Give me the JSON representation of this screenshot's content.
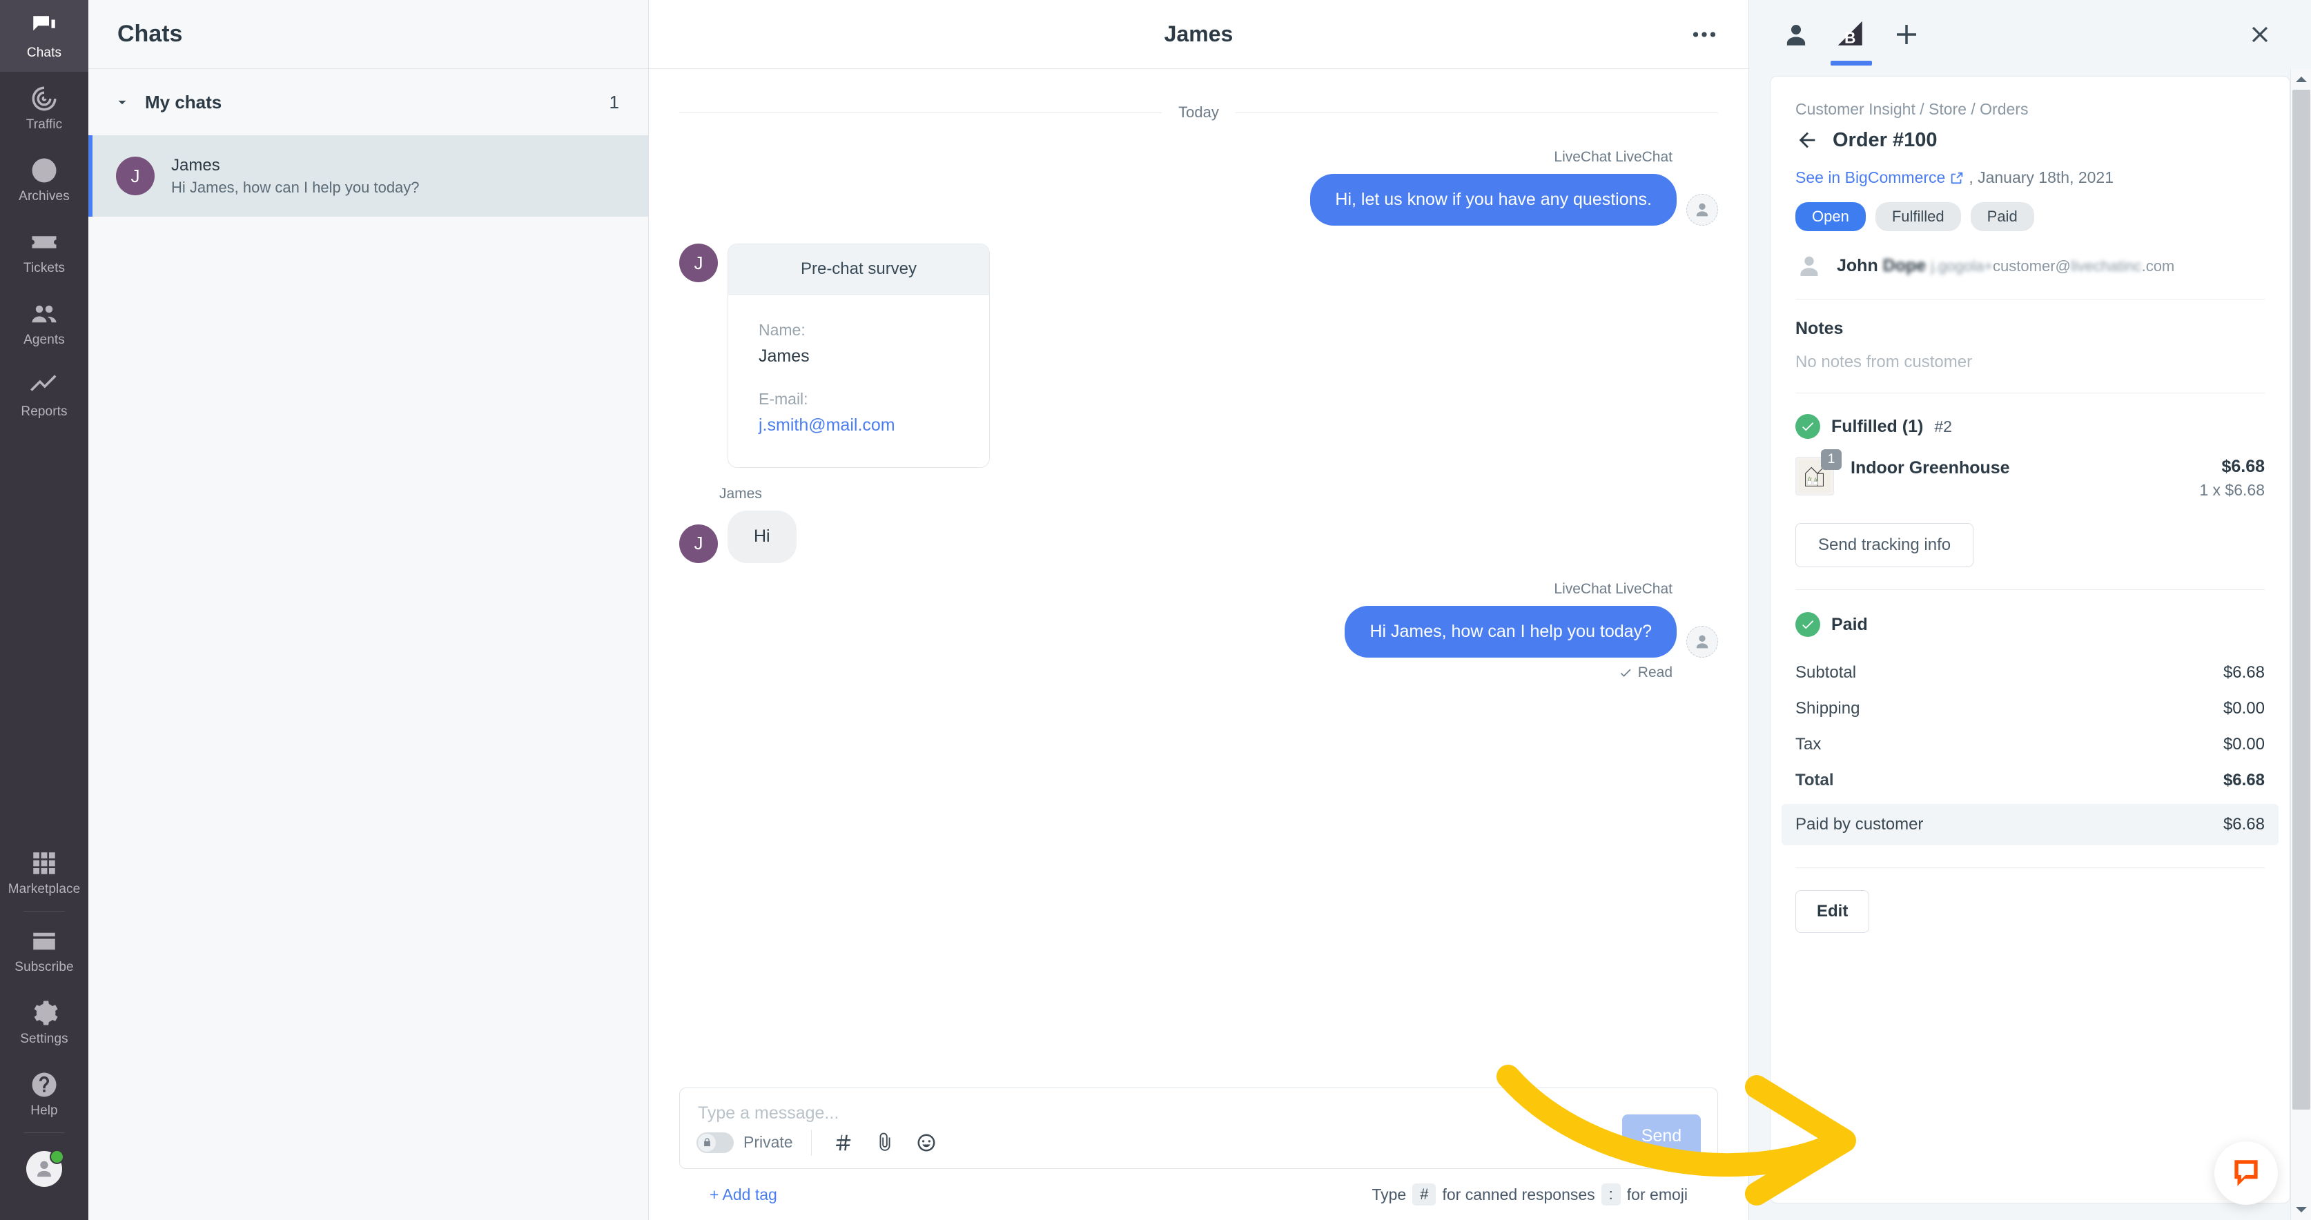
{
  "nav": {
    "top_items": [
      {
        "label": "Chats",
        "icon": "chats-icon",
        "active": true
      },
      {
        "label": "Traffic",
        "icon": "traffic-icon",
        "active": false
      },
      {
        "label": "Archives",
        "icon": "archives-clock-icon",
        "active": false
      },
      {
        "label": "Tickets",
        "icon": "tickets-icon",
        "active": false
      },
      {
        "label": "Agents",
        "icon": "agents-people-icon",
        "active": false
      },
      {
        "label": "Reports",
        "icon": "reports-chart-icon",
        "active": false
      }
    ],
    "bottom_items": [
      {
        "label": "Marketplace",
        "icon": "marketplace-grid-icon"
      },
      {
        "label": "Subscribe",
        "icon": "subscribe-card-icon"
      },
      {
        "label": "Settings",
        "icon": "gear-icon"
      },
      {
        "label": "Help",
        "icon": "help-question-icon"
      }
    ]
  },
  "chatlist": {
    "title": "Chats",
    "group_label": "My chats",
    "group_count": "1",
    "rows": [
      {
        "initial": "J",
        "name": "James",
        "preview": "Hi James, how can I help you today?"
      }
    ]
  },
  "conversation": {
    "title": "James",
    "day_label": "Today",
    "messages": [
      {
        "kind": "outgoing",
        "author": "LiveChat LiveChat",
        "text": "Hi, let us know if you have any questions."
      },
      {
        "kind": "survey",
        "initial": "J",
        "card_title": "Pre-chat survey",
        "fields": [
          {
            "label": "Name:",
            "value": "James",
            "is_link": false
          },
          {
            "label": "E-mail:",
            "value": "j.smith@mail.com",
            "is_link": true
          }
        ]
      },
      {
        "kind": "incoming",
        "author": "James",
        "initial": "J",
        "text": "Hi"
      },
      {
        "kind": "outgoing",
        "author": "LiveChat LiveChat",
        "text": "Hi James, how can I help you today?",
        "status": "Read"
      }
    ]
  },
  "composer": {
    "placeholder": "Type a message...",
    "private_label": "Private",
    "send_label": "Send",
    "add_tag_label": "+ Add tag",
    "hint_prefix": "Type",
    "hint_hash": "#",
    "hint_middle": "for canned responses",
    "hint_colon": ":",
    "hint_suffix": "for emoji",
    "icons": [
      "lock-icon",
      "hash-icon",
      "paperclip-icon",
      "emoji-smiley-icon"
    ]
  },
  "details": {
    "tabs": [
      {
        "icon": "customer-person-icon",
        "active": false
      },
      {
        "icon": "bigcommerce-logo-icon",
        "active": true
      },
      {
        "icon": "plus-icon",
        "active": false
      }
    ],
    "close_icon": "close-icon",
    "breadcrumb": "Customer Insight / Store / Orders",
    "order_title": "Order #100",
    "back_icon": "back-arrow-icon",
    "see_link": "See in BigCommerce",
    "external_icon": "external-link-icon",
    "see_date": ", January 18th, 2021",
    "badges": [
      {
        "label": "Open",
        "style": "open"
      },
      {
        "label": "Fulfilled",
        "style": "grey"
      },
      {
        "label": "Paid",
        "style": "grey"
      }
    ],
    "customer": {
      "name_visible": "John",
      "name_redacted": "Dope",
      "email_redacted_start": "j.gogola+",
      "email_visible": "customer@",
      "email_redacted_end": "livechatinc",
      "email_tail": ".com"
    },
    "notes": {
      "title": "Notes",
      "empty": "No notes from customer"
    },
    "fulfillment": {
      "label": "Fulfilled (1)",
      "ref": "#2",
      "items": [
        {
          "qty": "1",
          "name": "Indoor Greenhouse",
          "price": "$6.68",
          "unit": "1 x $6.68",
          "thumb": "greenhouse-product-thumb"
        }
      ],
      "tracking_button": "Send tracking info"
    },
    "payment": {
      "label": "Paid",
      "rows": [
        {
          "label": "Subtotal",
          "value": "$6.68",
          "bold": false
        },
        {
          "label": "Shipping",
          "value": "$0.00",
          "bold": false
        },
        {
          "label": "Tax",
          "value": "$0.00",
          "bold": false
        },
        {
          "label": "Total",
          "value": "$6.68",
          "bold": true
        }
      ],
      "paid_by_label": "Paid by customer",
      "paid_by_value": "$6.68"
    },
    "edit_button": "Edit"
  },
  "widget": {
    "icon": "livechat-bubble-icon"
  },
  "colors": {
    "accent_blue": "#4a7ef0",
    "nav_dark": "#3a363f",
    "avatar_purple": "#77527c",
    "success_green": "#4bb87a",
    "annotation_yellow": "#fcc60a",
    "livechat_orange": "#ff5100"
  }
}
